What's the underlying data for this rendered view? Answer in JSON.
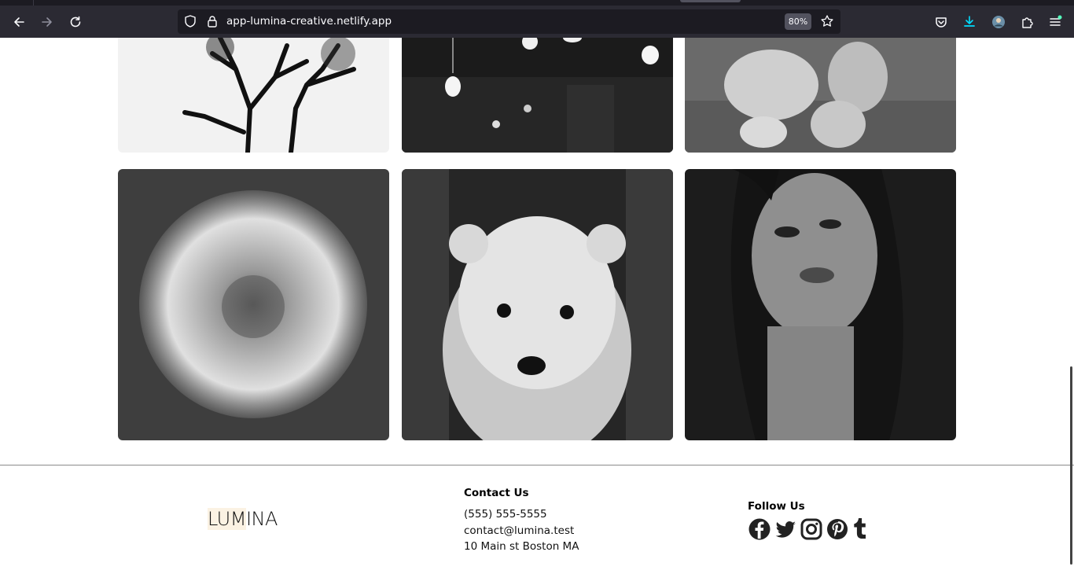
{
  "browser": {
    "url": "app-lumina-creative.netlify.app",
    "zoom": "80%"
  },
  "gallery": {
    "tiles": [
      {
        "subject": "tree silhouette"
      },
      {
        "subject": "hanging light bulbs"
      },
      {
        "subject": "plush lion toy"
      },
      {
        "subject": "dandelion seed head"
      },
      {
        "subject": "polar bear cub"
      },
      {
        "subject": "woman portrait"
      }
    ]
  },
  "footer": {
    "logo_a": "LUM",
    "logo_b": "INA",
    "contact_title": "Contact Us",
    "phone": "(555) 555-5555",
    "email": "contact@lumina.test",
    "address": "10 Main st Boston MA",
    "follow_title": "Follow Us",
    "socials": [
      "facebook-icon",
      "twitter-icon",
      "instagram-icon",
      "pinterest-icon",
      "tumblr-icon"
    ]
  },
  "colors": {
    "chrome_bg": "#2b2a33",
    "urlbar_bg": "#1c1b22",
    "download_accent": "#00ddff"
  }
}
